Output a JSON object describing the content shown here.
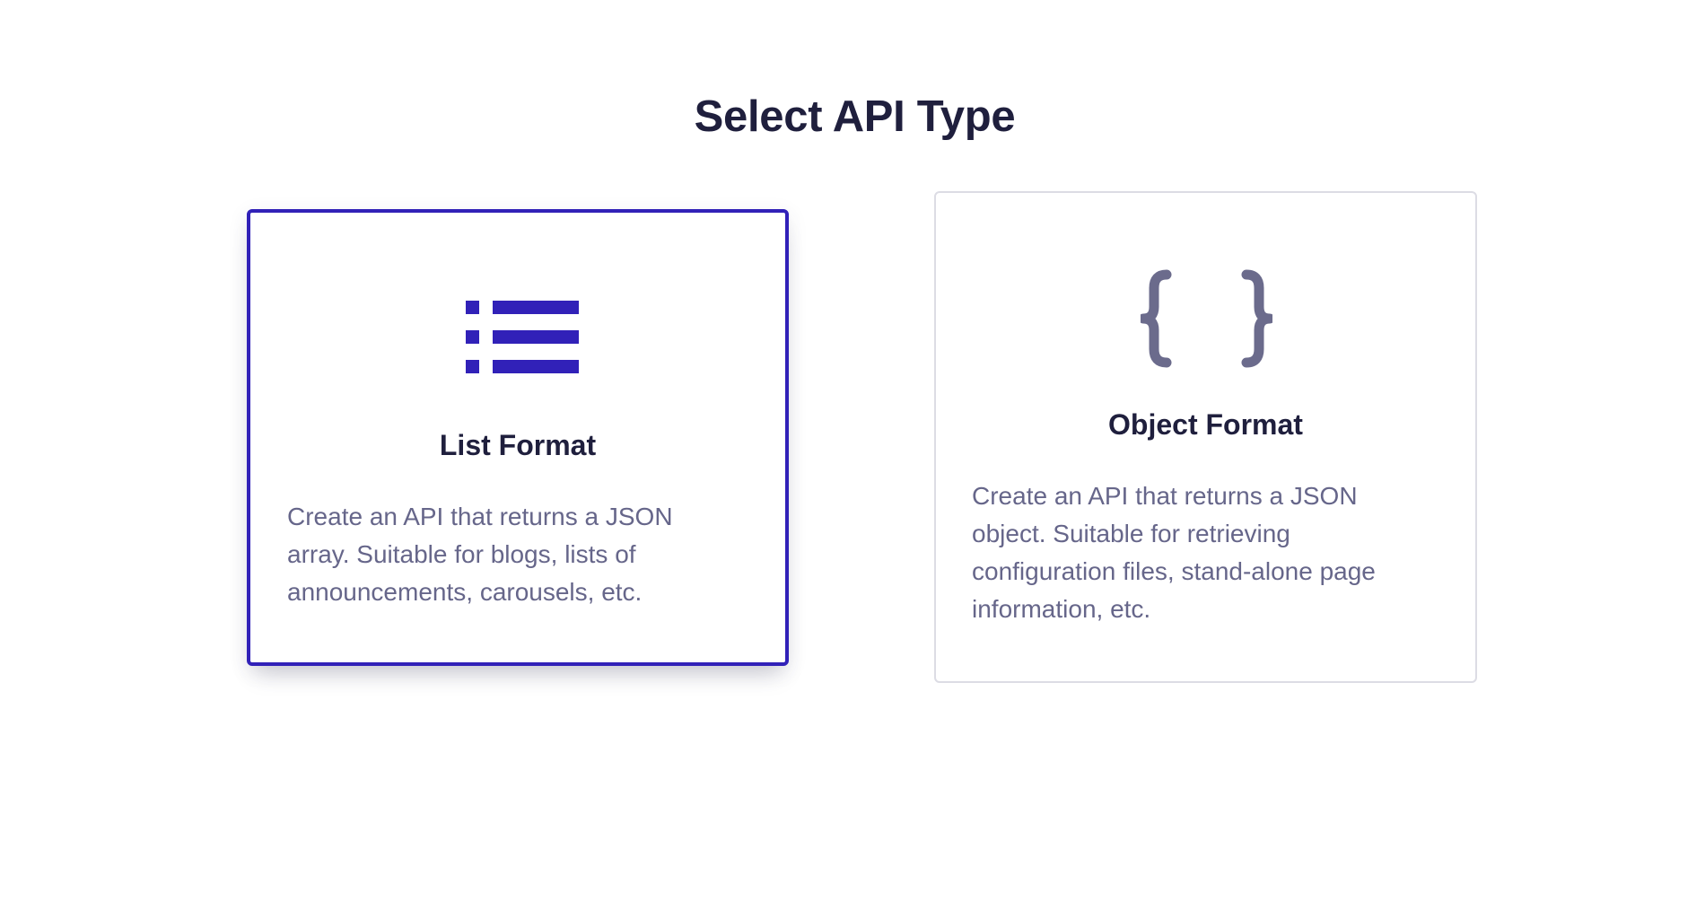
{
  "page": {
    "title": "Select API Type"
  },
  "cards": [
    {
      "title": "List Format",
      "description": "Create an API that returns a JSON array. Suitable for blogs, lists of announcements, carousels, etc.",
      "icon": "list-icon",
      "selected": true,
      "accent_color": "#3121b8"
    },
    {
      "title": "Object Format",
      "description": "Create an API that returns a JSON object. Suitable for retrieving configuration files, stand-alone page information, etc.",
      "icon": "curly-braces-icon",
      "selected": false,
      "accent_color": "#6b6b8c"
    }
  ]
}
